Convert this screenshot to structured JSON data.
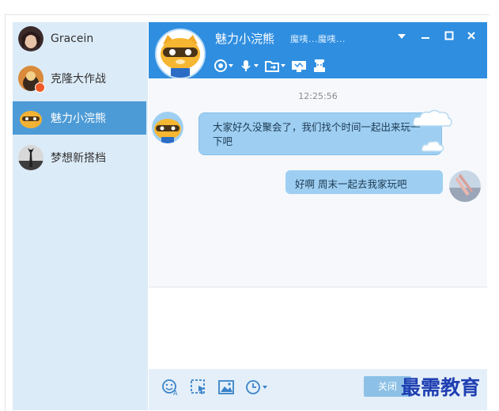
{
  "contacts": [
    {
      "name": "Gracein",
      "status": ""
    },
    {
      "name": "克隆大作战",
      "status": "busy"
    },
    {
      "name": "魅力小浣熊",
      "status": "",
      "active": true
    },
    {
      "name": "梦想新搭档",
      "status": ""
    }
  ],
  "chat": {
    "title": "魅力小浣熊",
    "status_text": "魔咦...魔咦...",
    "timestamp": "12:25:56",
    "messages": [
      {
        "from": "them",
        "text": "大家好久没聚会了，我们找个时间一起出来玩一下吧"
      },
      {
        "from": "me",
        "text": "好啊 周末一起去我家玩吧"
      }
    ],
    "close_label": "关闭"
  },
  "watermark": "最需教育",
  "colors": {
    "header": "#2f8ee0",
    "sidebar": "#dcebf8",
    "active": "#4d9bd6",
    "bubble": "#9ecff2"
  }
}
